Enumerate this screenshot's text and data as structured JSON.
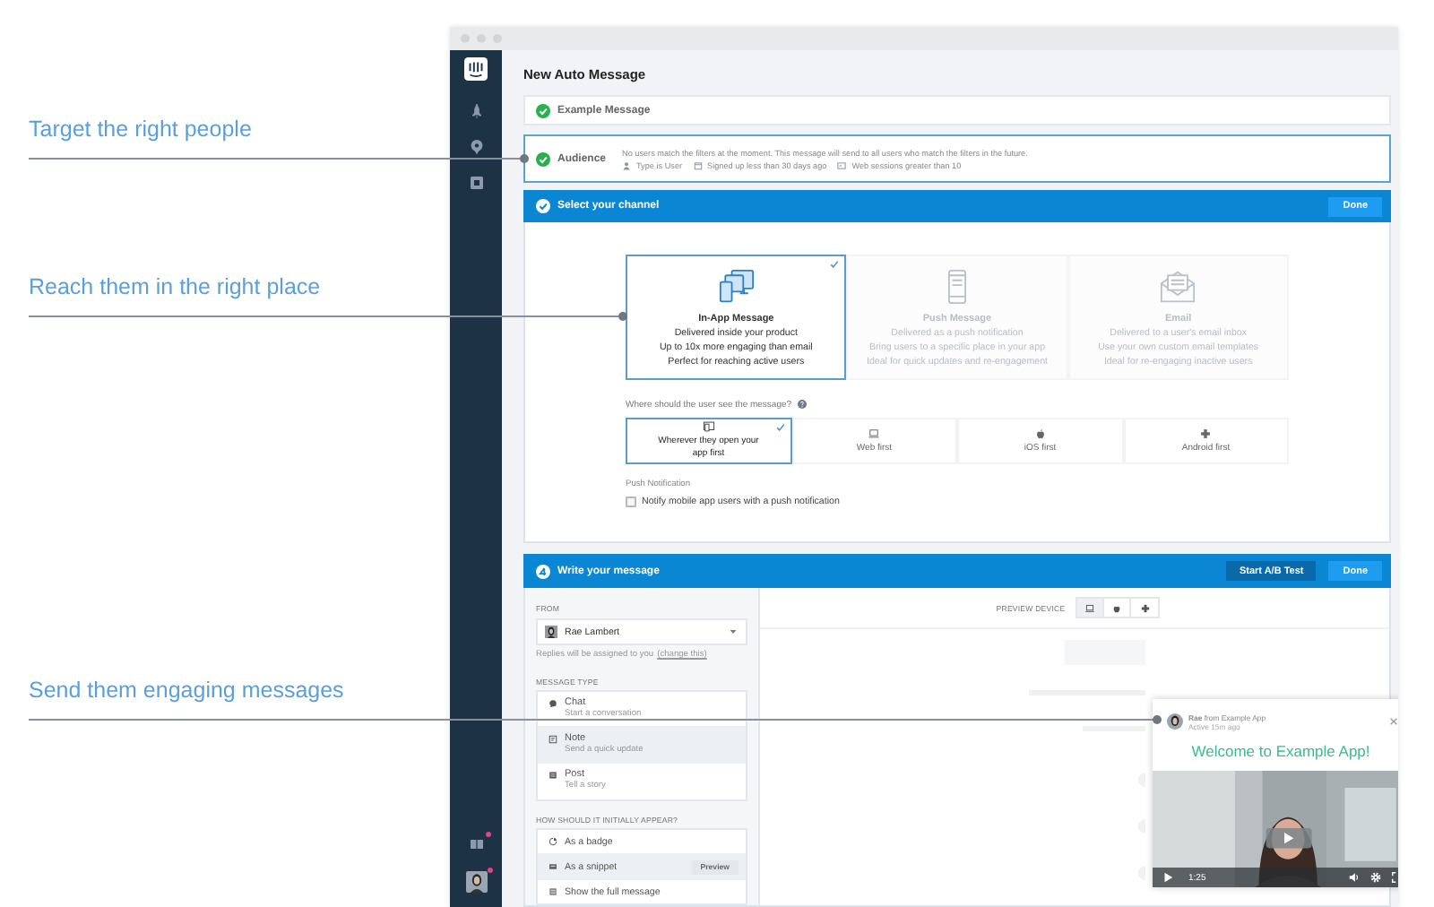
{
  "callouts": [
    {
      "text": "Target the right people"
    },
    {
      "text": "Reach them in the right place"
    },
    {
      "text": "Send them engaging messages"
    }
  ],
  "sidebar": {
    "items": [
      {
        "kind": "rocket"
      },
      {
        "kind": "pin"
      },
      {
        "kind": "box"
      }
    ],
    "bottom_items": [
      {
        "kind": "book",
        "notify": true
      },
      {
        "kind": "avatar",
        "notify": true
      }
    ]
  },
  "window": {
    "title": "New Auto Message"
  },
  "example_step": {
    "label": "Example Message",
    "complete": true
  },
  "audience_step": {
    "label": "Audience",
    "complete": true,
    "note": "No users match the filters at the moment. This message will send to all users who match the filters in the future.",
    "filters": [
      {
        "kind": "user",
        "text": "Type is User"
      },
      {
        "kind": "calendar",
        "text": "Signed up less than 30 days ago"
      },
      {
        "kind": "sessions",
        "text": "Web sessions greater than 10"
      }
    ]
  },
  "channel_section": {
    "title": "Select your channel",
    "done_button": "Done",
    "channels": [
      {
        "kind": "inapp",
        "title": "In-App Message",
        "lines": [
          "Delivered inside your product",
          "Up to 10x more engaging than email",
          "Perfect for reaching active users"
        ],
        "selected": true
      },
      {
        "kind": "push",
        "title": "Push Message",
        "lines": [
          "Delivered as a push notification",
          "Bring users to a specific place in your app",
          "Ideal for quick updates and re-engagement"
        ],
        "selected": false
      },
      {
        "kind": "email",
        "title": "Email",
        "lines": [
          "Delivered to a user's email inbox",
          "Use your own custom email templates",
          "Ideal for re-engaging inactive users"
        ],
        "selected": false
      }
    ],
    "placement_question": "Where should the user see the message?",
    "placements": [
      {
        "kind": "anywhere",
        "label": "Wherever they open your app first",
        "selected": true
      },
      {
        "kind": "web",
        "label": "Web first",
        "selected": false
      },
      {
        "kind": "ios",
        "label": "iOS first",
        "selected": false
      },
      {
        "kind": "android",
        "label": "Android first",
        "selected": false
      }
    ],
    "push_label": "Push Notification",
    "push_option": {
      "label": "Notify mobile app users with a push notification",
      "checked": false
    }
  },
  "message_section": {
    "title": "Write your message",
    "ab_button": "Start A/B Test",
    "done_button": "Done",
    "from_label": "FROM",
    "sender": "Rae Lambert",
    "replies_note": "Replies will be assigned to you",
    "change_link": "(change this)",
    "type_label": "MESSAGE TYPE",
    "types": [
      {
        "kind": "chat",
        "title": "Chat",
        "subtitle": "Start a conversation",
        "selected": false
      },
      {
        "kind": "note",
        "title": "Note",
        "subtitle": "Send a quick update",
        "selected": true
      },
      {
        "kind": "post",
        "title": "Post",
        "subtitle": "Tell a story",
        "selected": false
      }
    ],
    "appear_label": "HOW SHOULD IT INITIALLY APPEAR?",
    "appearances": [
      {
        "kind": "badge",
        "label": "As a badge",
        "selected": false
      },
      {
        "kind": "snippet",
        "label": "As a snippet",
        "selected": true,
        "tag": "Preview"
      },
      {
        "kind": "full",
        "label": "Show the full message",
        "selected": false
      }
    ],
    "preview_label": "PREVIEW DEVICE",
    "devices": [
      {
        "kind": "web",
        "selected": true
      },
      {
        "kind": "ios",
        "selected": false
      },
      {
        "kind": "android",
        "selected": false
      }
    ],
    "preview": {
      "sender": "**Rae** from Example App",
      "status": "Active 15m ago",
      "headline": "Welcome to Example App!",
      "video_time": "1:25"
    }
  }
}
